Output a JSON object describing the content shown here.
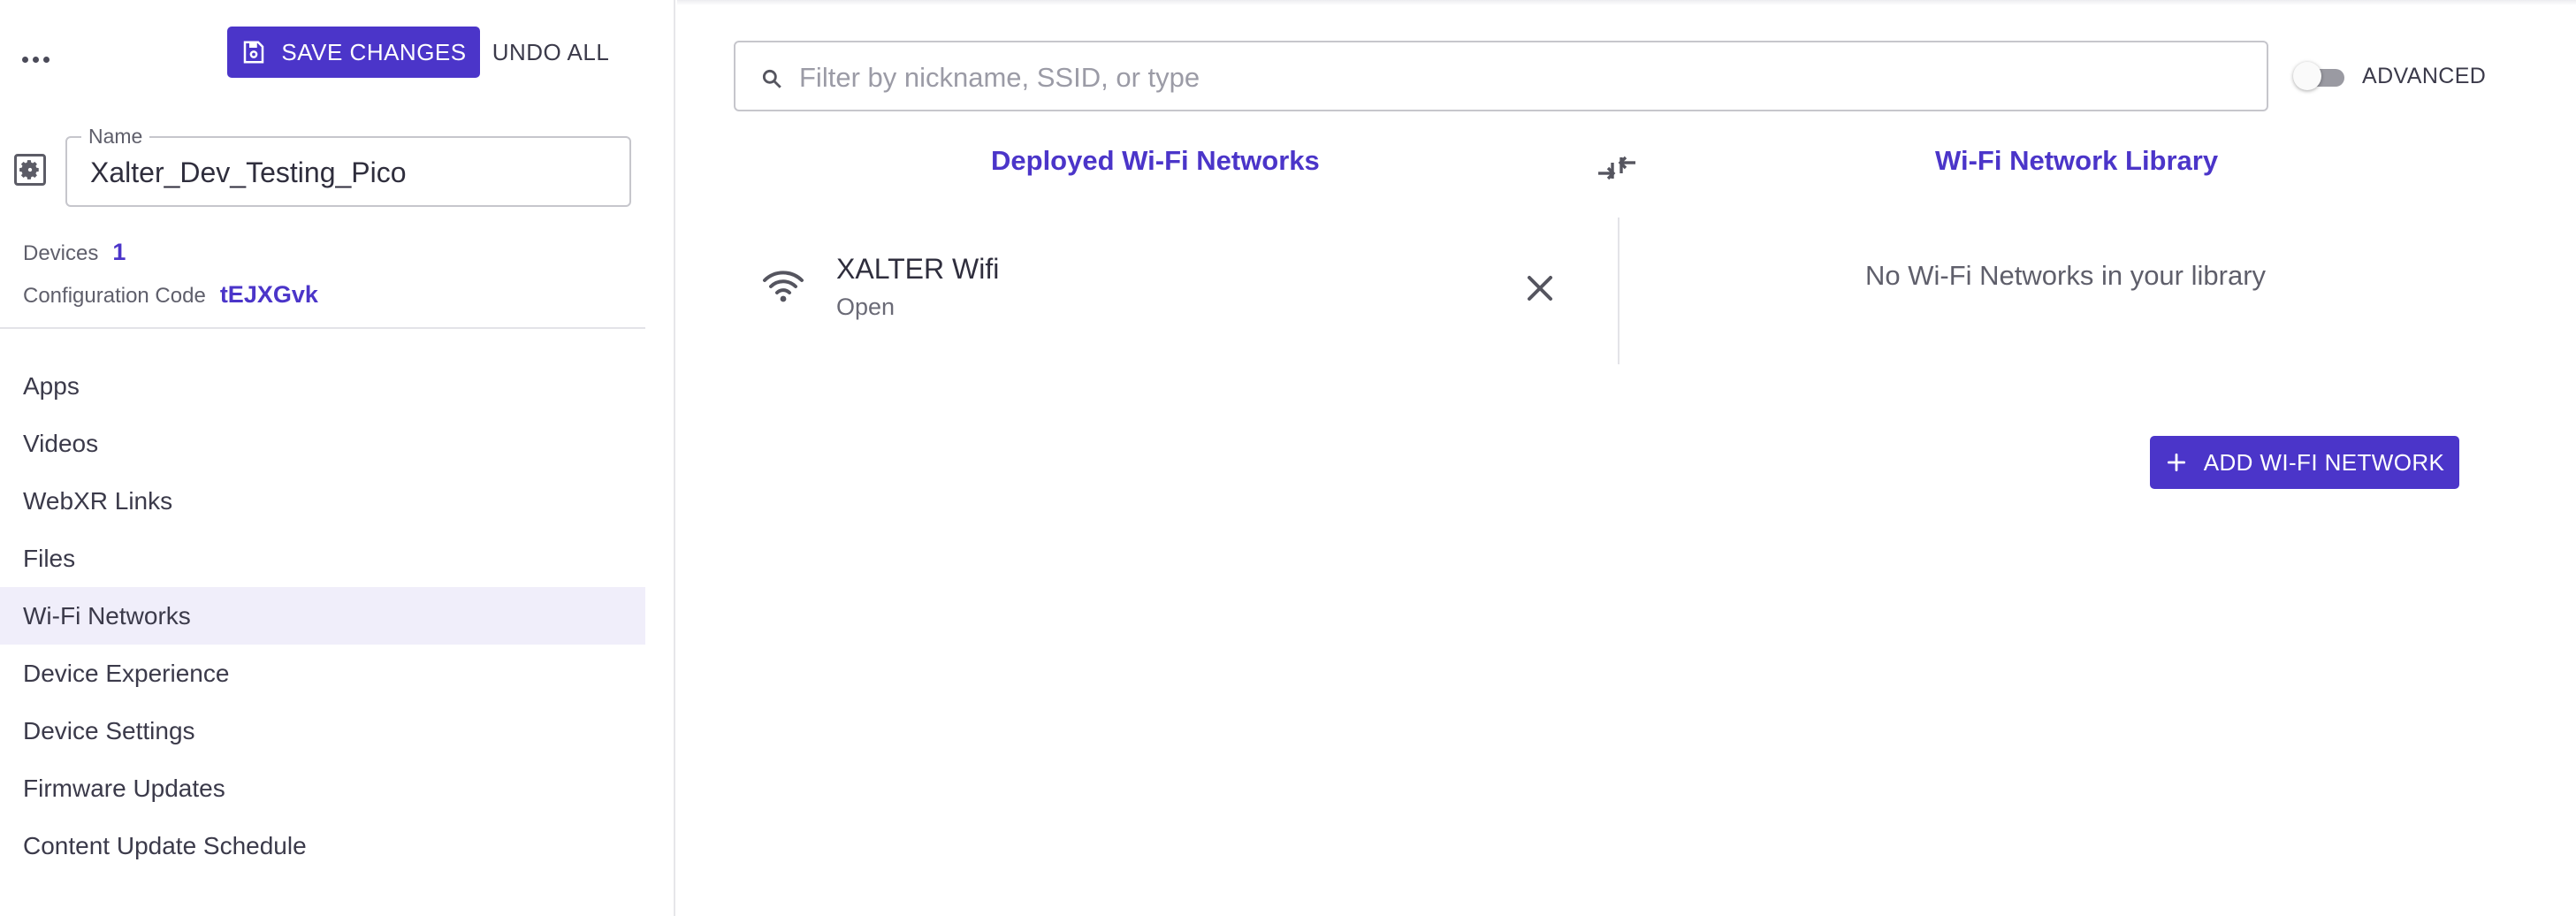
{
  "colors": {
    "accent": "#4b35c9",
    "active_bg": "#f0eefa",
    "text": "#3b3a4a"
  },
  "sidebar": {
    "more_icon": "more-horizontal-icon",
    "save_label": "SAVE CHANGES",
    "save_icon": "floppy-disk-icon",
    "undo_label": "UNDO ALL",
    "settings_icon": "gear-icon",
    "name_label": "Name",
    "name_value": "Xalter_Dev_Testing_Pico",
    "devices_label": "Devices",
    "devices_value": "1",
    "config_label": "Configuration Code",
    "config_value": "tEJXGvk",
    "nav": [
      {
        "label": "Apps",
        "active": false
      },
      {
        "label": "Videos",
        "active": false
      },
      {
        "label": "WebXR Links",
        "active": false
      },
      {
        "label": "Files",
        "active": false
      },
      {
        "label": "Wi-Fi Networks",
        "active": true
      },
      {
        "label": "Device Experience",
        "active": false
      },
      {
        "label": "Device Settings",
        "active": false
      },
      {
        "label": "Firmware Updates",
        "active": false
      },
      {
        "label": "Content Update Schedule",
        "active": false
      }
    ]
  },
  "main": {
    "search_placeholder": "Filter by nickname, SSID, or type",
    "search_value": "",
    "advanced_label": "ADVANCED",
    "advanced_on": false,
    "deployed_title": "Deployed Wi-Fi Networks",
    "library_title": "Wi-Fi Network Library",
    "deployed": [
      {
        "name": "XALTER Wifi",
        "security": "Open",
        "icon": "wifi-icon"
      }
    ],
    "library_empty": "No Wi-Fi Networks in your library",
    "add_label": "ADD WI-FI NETWORK",
    "add_icon": "plus-icon"
  }
}
